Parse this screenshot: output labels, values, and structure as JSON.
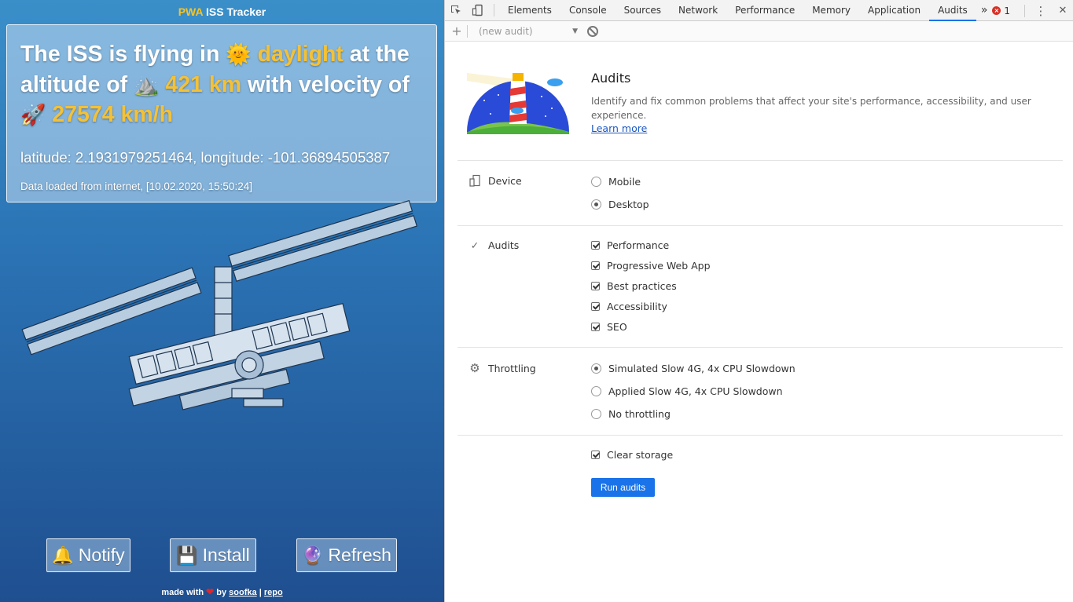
{
  "app": {
    "title_pwa": "PWA",
    "title_rest": " ISS Tracker",
    "headline": {
      "part1": "The ISS is flying in ",
      "sun_emoji": "🌞",
      "daylight": "daylight",
      "part2": " at the altitude of ",
      "mountain_emoji": "⛰️",
      "altitude": "421 km",
      "part3": " with velocity of ",
      "rocket_emoji": "🚀",
      "velocity": "27574 km/h"
    },
    "coords": "latitude: 2.1931979251464, longitude: -101.36894505387",
    "loaded": "Data loaded from internet, [10.02.2020, 15:50:24]",
    "buttons": {
      "notify_icon": "🔔",
      "notify": "Notify",
      "install_icon": "💾",
      "install": "Install",
      "refresh_icon": "🔮",
      "refresh": "Refresh"
    },
    "footer": {
      "made_with": "made with ",
      "heart": "❤",
      "by": " by ",
      "author": "soofka",
      "sep": " | ",
      "repo": "repo"
    }
  },
  "devtools": {
    "tabs": [
      "Elements",
      "Console",
      "Sources",
      "Network",
      "Performance",
      "Memory",
      "Application",
      "Audits"
    ],
    "active_tab": "Audits",
    "more_tabs": "»",
    "error_count": "1",
    "error_symbol": "×",
    "menu_icon": "⋮",
    "close_icon": "✕",
    "toolbar": {
      "add": "+",
      "audit_select": "(new audit)",
      "dropdown_arrow": "▼"
    },
    "audits_title": "Audits",
    "audits_desc": "Identify and fix common problems that affect your site's performance, accessibility, and user experience.",
    "learn_more": "Learn more",
    "device": {
      "label": "Device",
      "options": [
        {
          "label": "Mobile",
          "selected": false
        },
        {
          "label": "Desktop",
          "selected": true
        }
      ]
    },
    "audits": {
      "label": "Audits",
      "icon": "✓",
      "options": [
        {
          "label": "Performance",
          "checked": true
        },
        {
          "label": "Progressive Web App",
          "checked": true
        },
        {
          "label": "Best practices",
          "checked": true
        },
        {
          "label": "Accessibility",
          "checked": true
        },
        {
          "label": "SEO",
          "checked": true
        }
      ]
    },
    "throttling": {
      "label": "Throttling",
      "icon": "⚙",
      "options": [
        {
          "label": "Simulated Slow 4G, 4x CPU Slowdown",
          "selected": true
        },
        {
          "label": "Applied Slow 4G, 4x CPU Slowdown",
          "selected": false
        },
        {
          "label": "No throttling",
          "selected": false
        }
      ]
    },
    "clear_storage": {
      "label": "Clear storage",
      "checked": true
    },
    "run_button": "Run audits",
    "colors": {
      "accent": "#1a73e8",
      "link": "#1a57c4",
      "highlight": "#f4c136"
    }
  }
}
